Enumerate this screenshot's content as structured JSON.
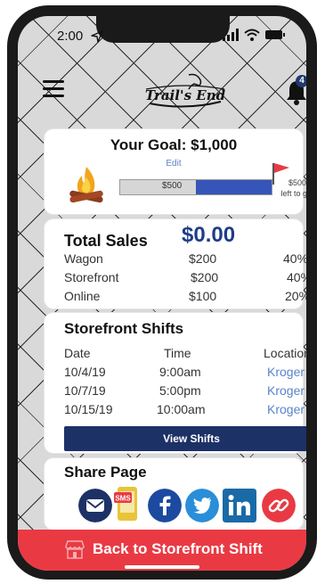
{
  "status": {
    "time": "2:00"
  },
  "header": {
    "logo_text": "Trail's End",
    "notification_count": "4"
  },
  "goal": {
    "title": "Your Goal: $1,000",
    "edit_label": "Edit",
    "progress_label": "$500",
    "progress_fraction": 0.5,
    "left_amount": "$500",
    "left_text": "left to go."
  },
  "sales": {
    "title": "Total Sales",
    "total": "$0.00",
    "rows": [
      {
        "channel": "Wagon",
        "amount": "$200",
        "percent": "40%"
      },
      {
        "channel": "Storefront",
        "amount": "$200",
        "percent": "40%"
      },
      {
        "channel": "Online",
        "amount": "$100",
        "percent": "20%"
      }
    ]
  },
  "shifts": {
    "title": "Storefront Shifts",
    "headers": [
      "Date",
      "Time",
      "Location"
    ],
    "rows": [
      {
        "date": "10/4/19",
        "time": "9:00am",
        "location": "Kroger"
      },
      {
        "date": "10/7/19",
        "time": "5:00pm",
        "location": "Kroger"
      },
      {
        "date": "10/15/19",
        "time": "10:00am",
        "location": "Kroger"
      }
    ],
    "button_label": "View Shifts"
  },
  "share": {
    "title": "Share Page",
    "sms_label": "SMS",
    "icons": [
      "email-icon",
      "sms-icon",
      "facebook-icon",
      "twitter-icon",
      "linkedin-icon",
      "link-icon"
    ]
  },
  "cta": {
    "label": "Back to Storefront Shift"
  },
  "colors": {
    "navy": "#1c3166",
    "accent_blue": "#3655b8",
    "link_blue": "#5b83c9",
    "cta_red": "#e93a44"
  }
}
